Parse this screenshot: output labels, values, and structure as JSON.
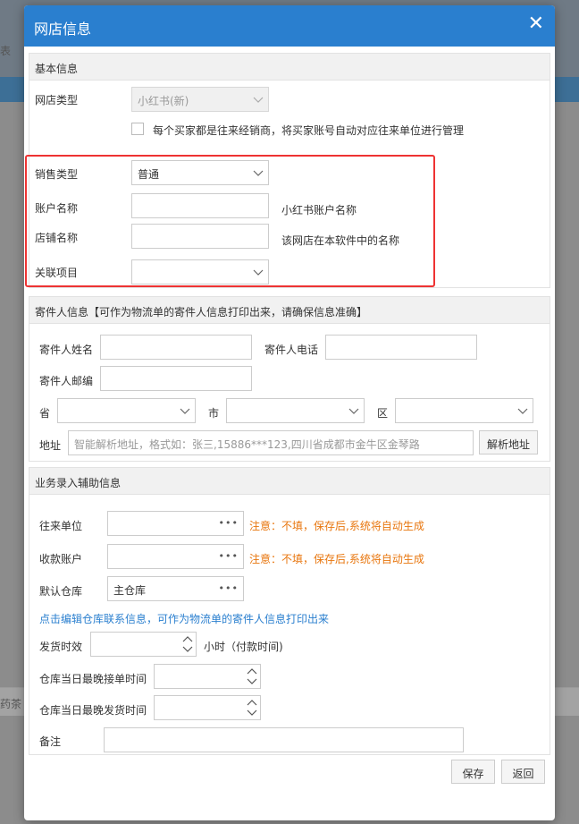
{
  "background": {
    "frag_top": "表",
    "frag_mid": "药茶"
  },
  "dialog": {
    "title": "网店信息",
    "close_label": "✕"
  },
  "basic": {
    "header": "基本信息",
    "shop_type_label": "网店类型",
    "shop_type_value": "小红书(新)",
    "checkbox_text": "每个买家都是往来经销商，将买家账号自动对应往来单位进行管理",
    "sales_type_label": "销售类型",
    "sales_type_value": "普通",
    "account_label": "账户名称",
    "account_value": "",
    "account_hint": "小红书账户名称",
    "store_label": "店铺名称",
    "store_value": "",
    "store_hint": "该网店在本软件中的名称",
    "project_label": "关联项目",
    "project_value": ""
  },
  "sender": {
    "header": "寄件人信息【可作为物流单的寄件人信息打印出来，请确保信息准确】",
    "name_label": "寄件人姓名",
    "name_value": "",
    "phone_label": "寄件人电话",
    "phone_value": "",
    "zip_label": "寄件人邮编",
    "zip_value": "",
    "province_label": "省",
    "city_label": "市",
    "district_label": "区",
    "address_label": "地址",
    "address_placeholder": "智能解析地址，格式如：张三,15886***123,四川省成都市金牛区金琴路",
    "parse_button": "解析地址"
  },
  "business": {
    "header": "业务录入辅助信息",
    "partner_label": "往来单位",
    "partner_value": "",
    "partner_note": "注意：不填，保存后,系统将自动生成",
    "account_label": "收款账户",
    "account_value": "",
    "account_note": "注意：不填，保存后,系统将自动生成",
    "warehouse_label": "默认仓库",
    "warehouse_value": "主仓库",
    "edit_link": "点击编辑仓库联系信息，可作为物流单的寄件人信息打印出来",
    "ship_time_label": "发货时效",
    "ship_time_value": "",
    "ship_time_unit": "小时（付款时间)",
    "latest_order_label": "仓库当日最晚接单时间",
    "latest_order_value": "",
    "latest_ship_label": "仓库当日最晚发货时间",
    "latest_ship_value": "",
    "remark_label": "备注",
    "remark_value": ""
  },
  "footer": {
    "save": "保存",
    "back": "返回"
  },
  "colors": {
    "accent": "#2a7fcf",
    "warning": "#e8760e",
    "highlight": "#e33333"
  }
}
